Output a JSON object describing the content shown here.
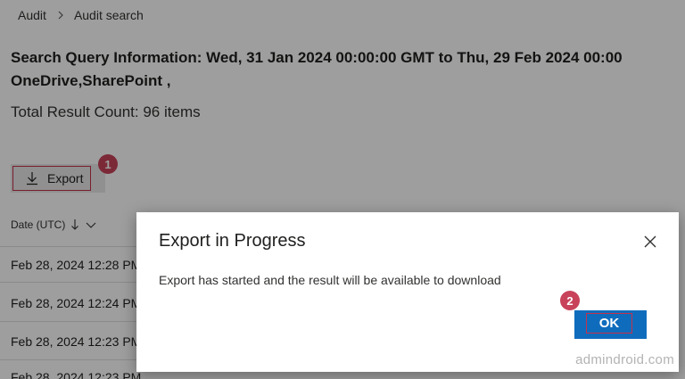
{
  "breadcrumb": {
    "root": "Audit",
    "current": "Audit search"
  },
  "query": {
    "title_line1": "Search Query Information: Wed, 31 Jan 2024 00:00:00 GMT to Thu, 29 Feb 2024 00:00",
    "title_line2": "OneDrive,SharePoint ,",
    "total": "Total Result Count: 96 items"
  },
  "toolbar": {
    "export_label": "Export",
    "export_icon": "download-icon"
  },
  "table": {
    "date_header": "Date (UTC)",
    "rows": [
      "Feb 28, 2024 12:28 PM",
      "Feb 28, 2024 12:24 PM",
      "Feb 28, 2024 12:23 PM",
      "Feb 28, 2024 12:23 PM"
    ]
  },
  "dialog": {
    "title": "Export in Progress",
    "message": "Export has started and the result will be available to download",
    "ok_label": "OK"
  },
  "callouts": {
    "step1": "1",
    "step2": "2"
  },
  "watermark": "admindroid.com",
  "colors": {
    "accent": "#0f6cbd",
    "callout": "#c8435a",
    "highlight_border": "#c4314b"
  }
}
